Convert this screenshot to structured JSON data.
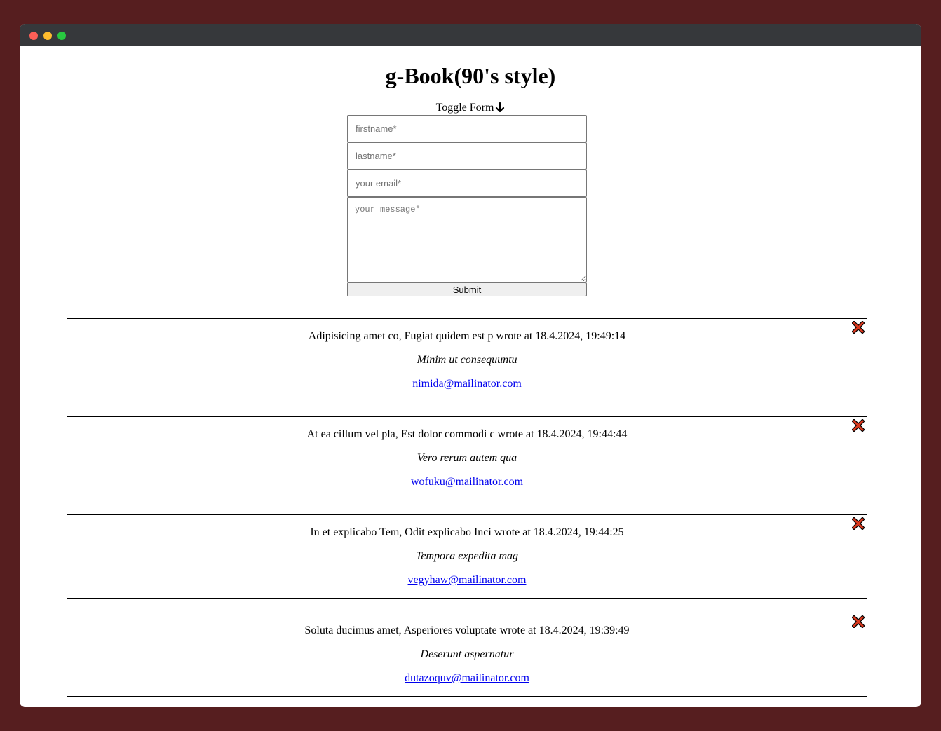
{
  "page": {
    "title": "g-Book(90's style)",
    "toggle_label": "Toggle Form"
  },
  "form": {
    "firstname_placeholder": "firstname*",
    "lastname_placeholder": "lastname*",
    "email_placeholder": "your email*",
    "message_placeholder": "your message*",
    "submit_label": "Submit"
  },
  "entries": [
    {
      "header": "Adipisicing amet co, Fugiat quidem est p wrote at 18.4.2024, 19:49:14",
      "message": "Minim ut consequuntu",
      "email": "nimida@mailinator.com"
    },
    {
      "header": "At ea cillum vel pla, Est dolor commodi c wrote at 18.4.2024, 19:44:44",
      "message": "Vero rerum autem qua",
      "email": "wofuku@mailinator.com"
    },
    {
      "header": "In et explicabo Tem, Odit explicabo Inci wrote at 18.4.2024, 19:44:25",
      "message": "Tempora expedita mag",
      "email": "vegyhaw@mailinator.com"
    },
    {
      "header": "Soluta ducimus amet, Asperiores voluptate wrote at 18.4.2024, 19:39:49",
      "message": "Deserunt aspernatur",
      "email": "dutazoquv@mailinator.com"
    }
  ],
  "colors": {
    "background": "#561e1f",
    "titlebar": "#36383b",
    "link": "#0000ee",
    "delete_icon": "#d9381e"
  },
  "icons": {
    "toggle": "arrow-down-icon",
    "delete": "close-x-icon"
  }
}
